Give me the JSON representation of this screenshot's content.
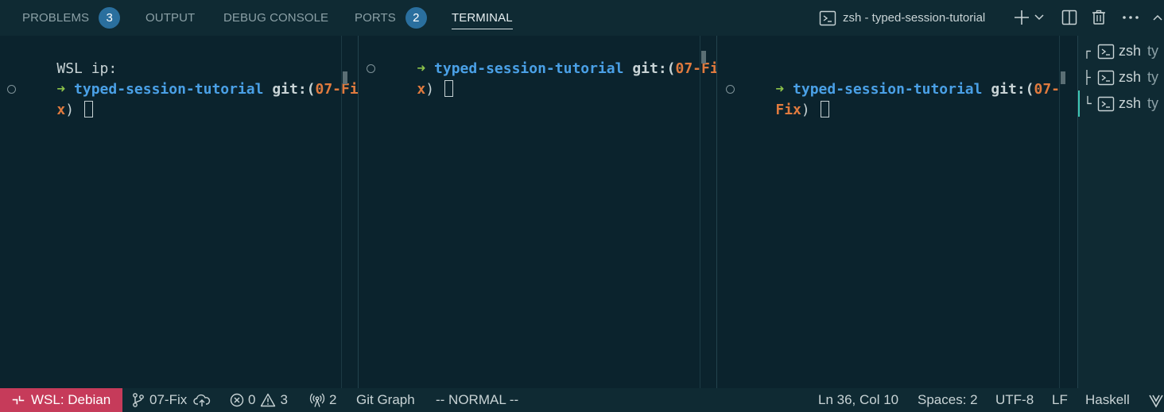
{
  "panel_tabs": [
    {
      "label": "PROBLEMS",
      "badge": "3"
    },
    {
      "label": "OUTPUT"
    },
    {
      "label": "DEBUG CONSOLE"
    },
    {
      "label": "PORTS",
      "badge": "2"
    },
    {
      "label": "TERMINAL"
    }
  ],
  "terminal_title": "zsh - typed-session-tutorial",
  "toolbar_icons": [
    "terminal-icon",
    "plus-icon",
    "chevron-down-icon",
    "split-icon",
    "trash-icon",
    "more-icon"
  ],
  "panes": [
    {
      "line0": "WSL ip:",
      "arrow": "➜",
      "dir": "typed-session-tutorial",
      "git": "git:(",
      "branch_part1": "07-Fi",
      "branch_part2": "x",
      "close": ")"
    },
    {
      "arrow": "➜",
      "dir": "typed-session-tutorial",
      "git": "git:(",
      "branch_part1": "07-Fi",
      "branch_part2": "x",
      "close": ")"
    },
    {
      "arrow": "➜",
      "dir": "typed-session-tutorial",
      "git": "git:(",
      "branch_part1": "07-",
      "branch_part2": "Fix",
      "close": ")"
    }
  ],
  "terminal_list": [
    {
      "tree": "┌",
      "label": "zsh",
      "sub": "ty"
    },
    {
      "tree": "├",
      "label": "zsh",
      "sub": "ty"
    },
    {
      "tree": "└",
      "label": "zsh",
      "sub": "ty"
    }
  ],
  "statusbar": {
    "remote": "WSL: Debian",
    "branch": "07-Fix",
    "errors": "0",
    "warnings": "3",
    "ports": "2",
    "git_graph": "Git Graph",
    "mode": "-- NORMAL --",
    "position": "Ln 36, Col 10",
    "spaces": "Spaces: 2",
    "encoding": "UTF-8",
    "eol": "LF",
    "language": "Haskell"
  },
  "colors": {
    "background": "#0b232d",
    "arrow": "#8dc34a",
    "directory": "#4aa0e6",
    "branch": "#e07a3e",
    "remote_bg": "#c63b5a",
    "badge_bg": "#2a6f9e",
    "active_indicator": "#3ec6b5"
  }
}
